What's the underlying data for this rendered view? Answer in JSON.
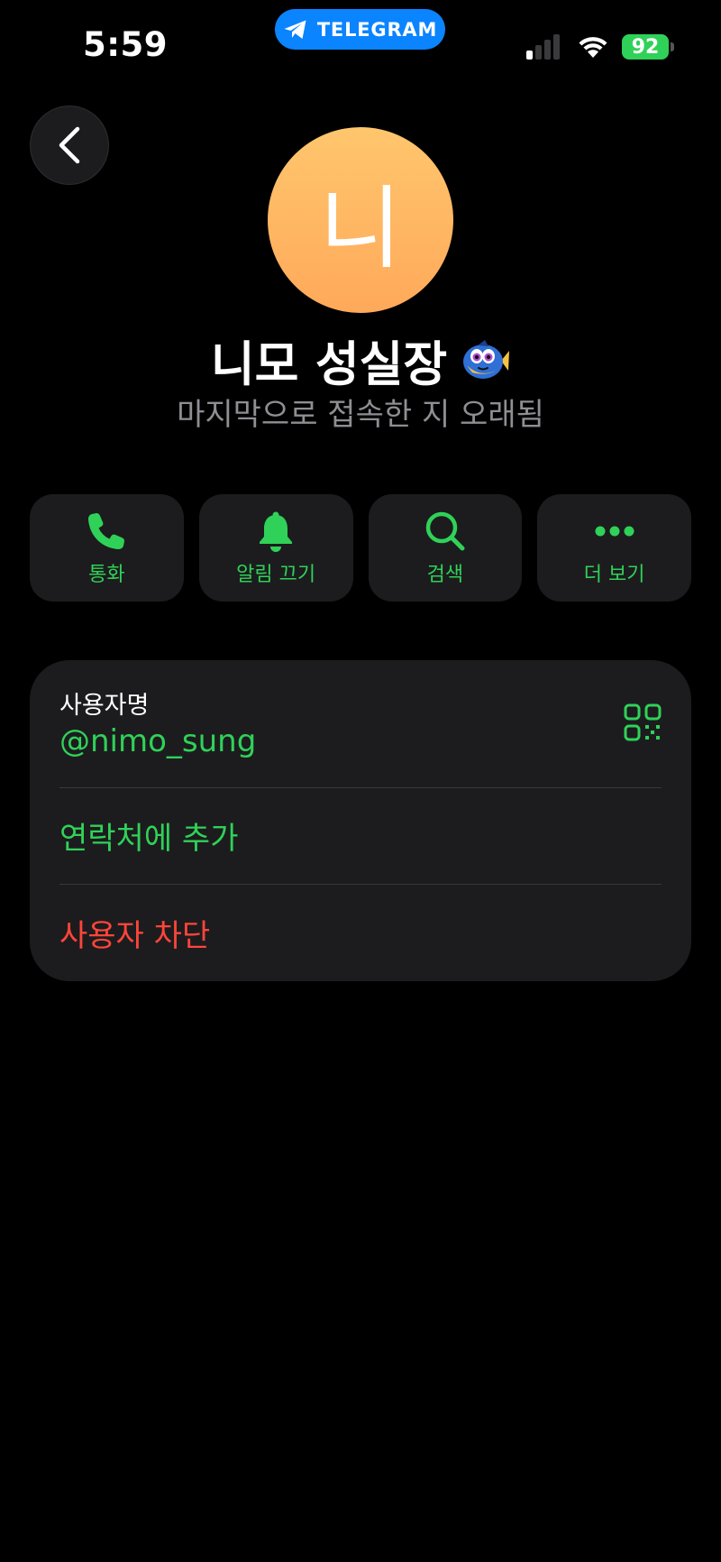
{
  "status_bar": {
    "time": "5:59",
    "pill_label": "TELEGRAM",
    "battery_level": "92",
    "signal_bars_on": 1,
    "signal_bars_total": 4
  },
  "profile": {
    "avatar_initial": "니",
    "name": "니모 성실장",
    "name_emoji": "fish-emoji",
    "last_seen": "마지막으로 접속한 지 오래됨"
  },
  "actions": [
    {
      "id": "call",
      "label": "통화",
      "icon": "phone-icon"
    },
    {
      "id": "mute",
      "label": "알림 끄기",
      "icon": "bell-icon"
    },
    {
      "id": "search",
      "label": "검색",
      "icon": "search-icon"
    },
    {
      "id": "more",
      "label": "더 보기",
      "icon": "more-icon"
    }
  ],
  "info": {
    "username_caption": "사용자명",
    "username": "@nimo_sung",
    "add_contact": "연락처에 추가",
    "block_user": "사용자 차단"
  },
  "colors": {
    "accent_green": "#30d158",
    "destructive_red": "#ff453a",
    "pill_blue": "#0a84ff",
    "card_bg": "#1c1c1e",
    "avatar_top": "#ffc66d",
    "avatar_bottom": "#ffa95a"
  }
}
